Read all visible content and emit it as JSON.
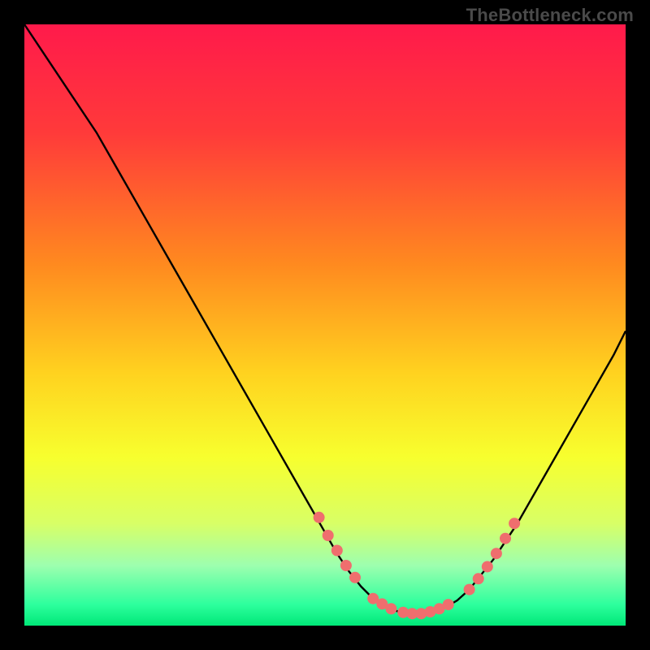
{
  "watermark": "TheBottleneck.com",
  "chart_data": {
    "type": "line",
    "title": "",
    "xlabel": "",
    "ylabel": "",
    "xlim": [
      0,
      100
    ],
    "ylim": [
      0,
      100
    ],
    "background_gradient": {
      "stops": [
        {
          "offset": 0.0,
          "color": "#ff1a4b"
        },
        {
          "offset": 0.18,
          "color": "#ff3a3a"
        },
        {
          "offset": 0.4,
          "color": "#ff8a1f"
        },
        {
          "offset": 0.58,
          "color": "#ffd21f"
        },
        {
          "offset": 0.72,
          "color": "#f7ff2e"
        },
        {
          "offset": 0.83,
          "color": "#d8ff66"
        },
        {
          "offset": 0.9,
          "color": "#9dffaf"
        },
        {
          "offset": 0.965,
          "color": "#2dff9d"
        },
        {
          "offset": 1.0,
          "color": "#00e878"
        }
      ]
    },
    "curve": {
      "x": [
        0,
        4,
        8,
        12,
        16,
        20,
        24,
        28,
        32,
        36,
        40,
        44,
        48,
        52,
        54,
        56,
        58,
        60,
        62,
        64,
        66,
        68,
        70,
        72,
        74,
        78,
        82,
        86,
        90,
        94,
        98,
        100
      ],
      "y": [
        100,
        94,
        88,
        82,
        75,
        68,
        61,
        54,
        47,
        40,
        33,
        26,
        19,
        12,
        9,
        6.5,
        4.5,
        3.2,
        2.4,
        2.0,
        2.0,
        2.3,
        3.0,
        4.2,
        6.0,
        11,
        17,
        24,
        31,
        38,
        45,
        49
      ]
    },
    "markers": {
      "color": "#ef6e6e",
      "radius": 7,
      "points": [
        {
          "x": 49,
          "y": 18
        },
        {
          "x": 50.5,
          "y": 15
        },
        {
          "x": 52,
          "y": 12.5
        },
        {
          "x": 53.5,
          "y": 10
        },
        {
          "x": 55,
          "y": 8
        },
        {
          "x": 58,
          "y": 4.5
        },
        {
          "x": 59.5,
          "y": 3.6
        },
        {
          "x": 61,
          "y": 2.8
        },
        {
          "x": 63,
          "y": 2.2
        },
        {
          "x": 64.5,
          "y": 2.0
        },
        {
          "x": 66,
          "y": 2.0
        },
        {
          "x": 67.5,
          "y": 2.3
        },
        {
          "x": 69,
          "y": 2.8
        },
        {
          "x": 70.5,
          "y": 3.5
        },
        {
          "x": 74,
          "y": 6.0
        },
        {
          "x": 75.5,
          "y": 7.8
        },
        {
          "x": 77,
          "y": 9.8
        },
        {
          "x": 78.5,
          "y": 12
        },
        {
          "x": 80,
          "y": 14.5
        },
        {
          "x": 81.5,
          "y": 17
        }
      ]
    }
  }
}
